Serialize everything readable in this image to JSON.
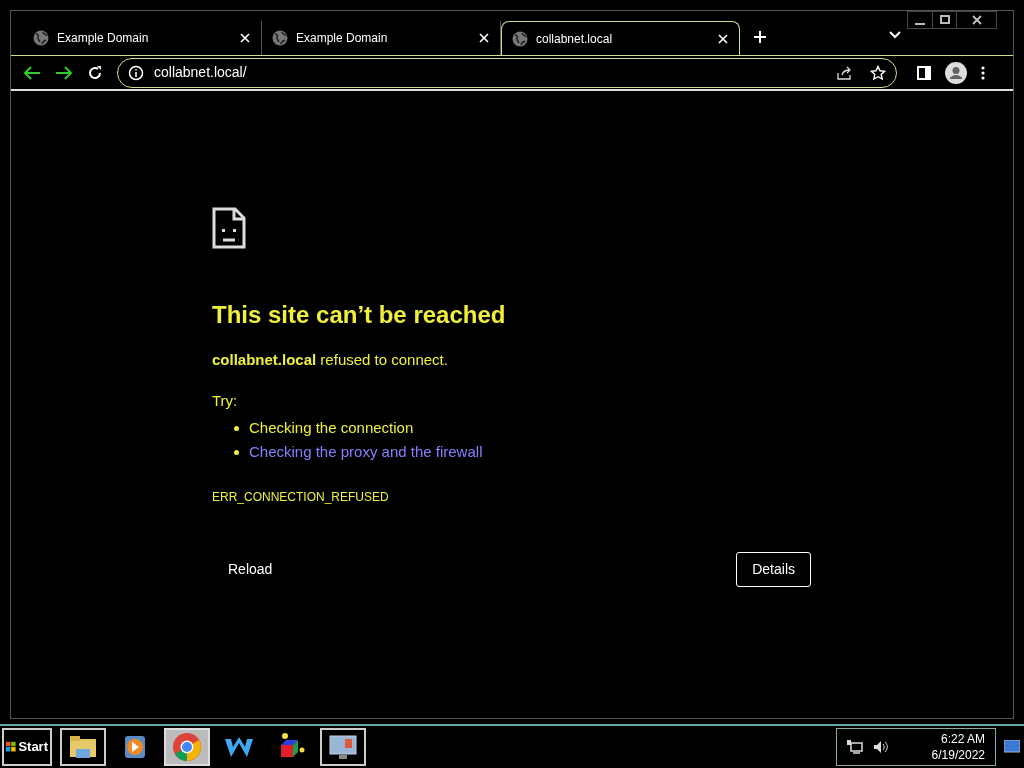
{
  "tabs": [
    {
      "title": "Example Domain",
      "selected": false
    },
    {
      "title": "Example Domain",
      "selected": false
    },
    {
      "title": "collabnet.local",
      "selected": true
    }
  ],
  "address_bar": {
    "url": "collabnet.local/"
  },
  "error_page": {
    "heading": "This site can’t be reached",
    "message": "**collabnet.local** refused to connect.",
    "try_label": "Try:",
    "suggestions": [
      {
        "text": "Checking the connection",
        "kind": "plain"
      },
      {
        "text": "Checking the proxy and the firewall",
        "kind": "link"
      }
    ],
    "error_code": "ERR_CONNECTION_REFUSED",
    "reload_button": "Reload",
    "details_button": "Details"
  },
  "taskbar": {
    "start": "Start",
    "apps": [
      {
        "kind": "folder",
        "selected": false
      },
      {
        "kind": "player",
        "selected": false
      },
      {
        "kind": "chrome",
        "selected": true
      },
      {
        "kind": "w",
        "selected": false
      },
      {
        "kind": "cube",
        "selected": false
      },
      {
        "kind": "monitor",
        "selected": false
      }
    ],
    "time": "6:22 AM",
    "date": "6/19/2022"
  }
}
